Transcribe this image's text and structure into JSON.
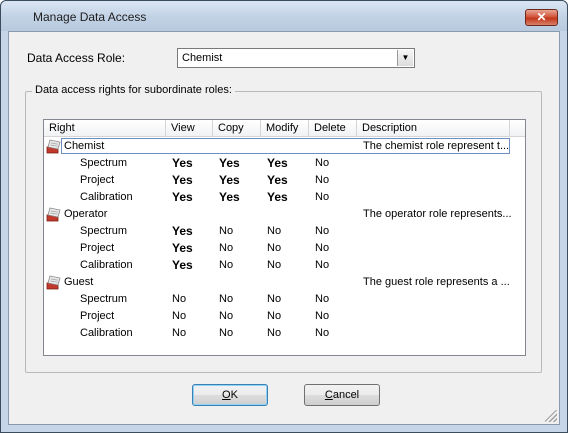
{
  "window": {
    "title": "Manage Data Access",
    "close_glyph": "✕"
  },
  "role": {
    "label": "Data Access Role:",
    "selected": "Chemist"
  },
  "group": {
    "label": "Data access rights for subordinate roles:"
  },
  "list": {
    "columns": [
      "Right",
      "View",
      "Copy",
      "Modify",
      "Delete",
      "Description"
    ],
    "rows": [
      {
        "kind": "role",
        "icon": "role-icon",
        "name": "Chemist",
        "description": "The chemist role represent t...",
        "selected": true
      },
      {
        "kind": "right",
        "name": "Spectrum",
        "view": "Yes",
        "copy": "Yes",
        "modify": "Yes",
        "delete": "No"
      },
      {
        "kind": "right",
        "name": "Project",
        "view": "Yes",
        "copy": "Yes",
        "modify": "Yes",
        "delete": "No"
      },
      {
        "kind": "right",
        "name": "Calibration",
        "view": "Yes",
        "copy": "Yes",
        "modify": "Yes",
        "delete": "No"
      },
      {
        "kind": "role",
        "icon": "role-icon",
        "name": "Operator",
        "description": "The operator role represents..."
      },
      {
        "kind": "right",
        "name": "Spectrum",
        "view": "Yes",
        "copy": "No",
        "modify": "No",
        "delete": "No"
      },
      {
        "kind": "right",
        "name": "Project",
        "view": "Yes",
        "copy": "No",
        "modify": "No",
        "delete": "No"
      },
      {
        "kind": "right",
        "name": "Calibration",
        "view": "Yes",
        "copy": "No",
        "modify": "No",
        "delete": "No"
      },
      {
        "kind": "role",
        "icon": "role-icon",
        "name": "Guest",
        "description": "The guest role represents a ..."
      },
      {
        "kind": "right",
        "name": "Spectrum",
        "view": "No",
        "copy": "No",
        "modify": "No",
        "delete": "No"
      },
      {
        "kind": "right",
        "name": "Project",
        "view": "No",
        "copy": "No",
        "modify": "No",
        "delete": "No"
      },
      {
        "kind": "right",
        "name": "Calibration",
        "view": "No",
        "copy": "No",
        "modify": "No",
        "delete": "No"
      }
    ]
  },
  "buttons": {
    "ok_mnemonic": "O",
    "ok_rest": "K",
    "cancel_mnemonic": "C",
    "cancel_rest": "ancel"
  },
  "colors": {
    "selection_border": "#6c8ec2",
    "title_bar": "#c3d3e6",
    "close_button": "#c3371b"
  }
}
